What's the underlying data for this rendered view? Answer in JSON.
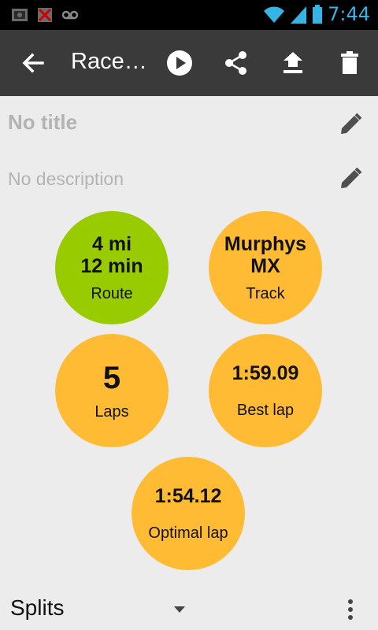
{
  "status_bar": {
    "time": "7:44",
    "icons": [
      "screenshot-icon",
      "no-sim-icon",
      "voicemail-icon",
      "wifi-icon",
      "signal-icon",
      "battery-icon"
    ]
  },
  "app_bar": {
    "title": "Race…",
    "icons": [
      "back-arrow-icon",
      "play-icon",
      "share-icon",
      "upload-icon",
      "delete-icon"
    ]
  },
  "details": {
    "title": "No title",
    "description": "No description"
  },
  "stats": {
    "route": {
      "line1": "4 mi",
      "line2": "12 min",
      "label": "Route",
      "color": "#99cc00"
    },
    "track": {
      "line1": "Murphys",
      "line2": "MX",
      "label": "Track",
      "color": "#ffbb33"
    },
    "laps": {
      "value": "5",
      "label": "Laps"
    },
    "best_lap": {
      "value": "1:59.09",
      "label": "Best lap"
    },
    "optimal_lap": {
      "value": "1:54.12",
      "label": "Optimal lap"
    }
  },
  "splits": {
    "label": "Splits"
  },
  "colors": {
    "accent_blue": "#33b5e5",
    "green": "#99cc00",
    "orange": "#ffbb33",
    "app_bar": "#3a3a3a"
  }
}
